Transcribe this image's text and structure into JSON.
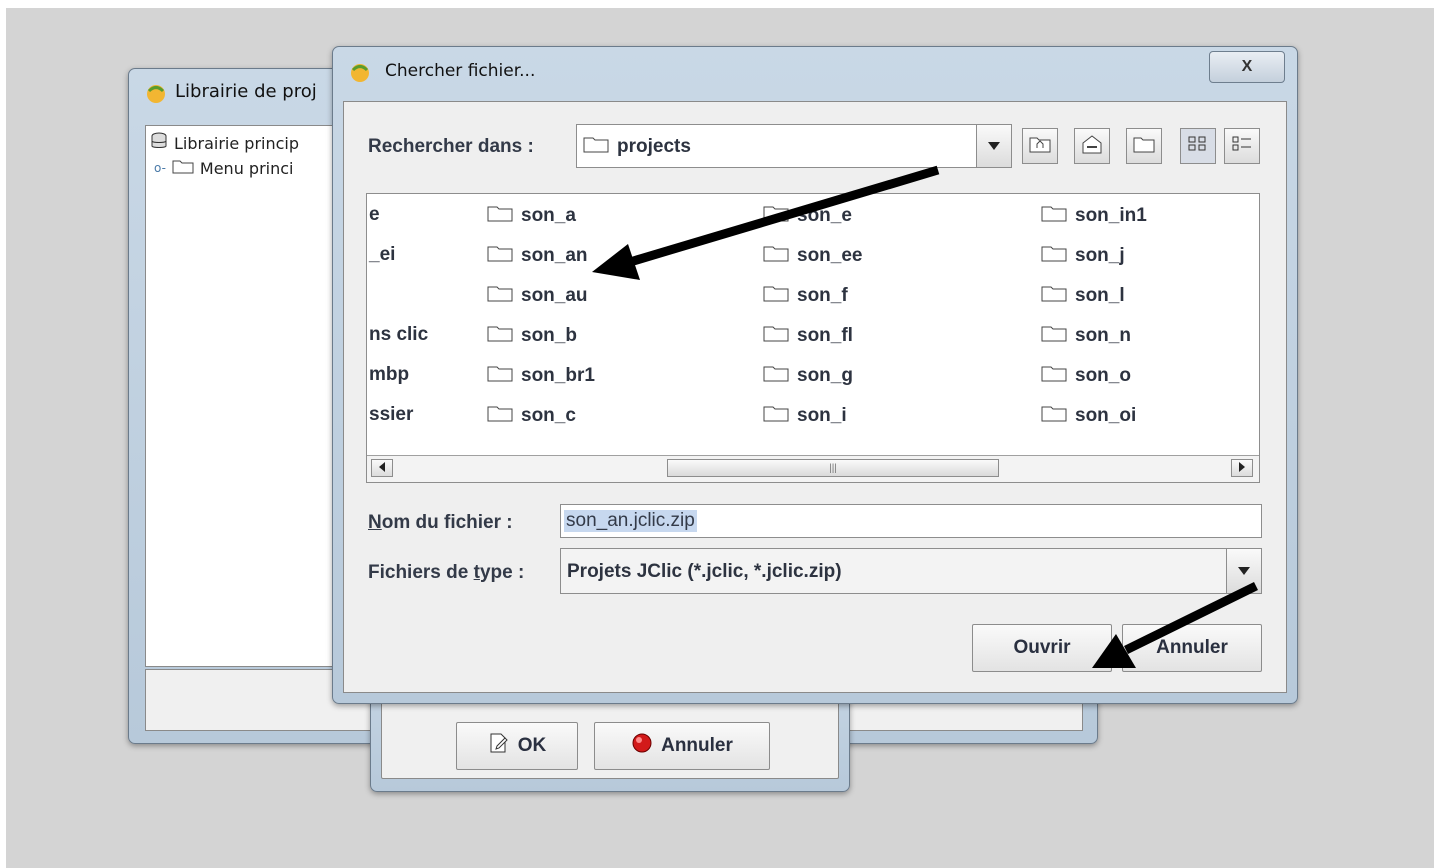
{
  "library_window": {
    "title": "Librairie de proj",
    "tree": [
      {
        "label": "Librairie princip",
        "icon": "database-icon"
      },
      {
        "label": "Menu princi",
        "icon": "folder-icon"
      }
    ]
  },
  "ok_dialog": {
    "ok_label": "OK",
    "cancel_label": "Annuler"
  },
  "chooser": {
    "title": "Chercher fichier...",
    "close_glyph": "X",
    "look_in_label": "Rechercher dans :",
    "look_in_value": "projects",
    "toolbar_icons": [
      "up-folder-icon",
      "home-icon",
      "new-folder-icon",
      "list-view-icon",
      "details-view-icon"
    ],
    "columns": [
      [
        "e",
        "_ei",
        "",
        "ns clic",
        "mbp",
        "ssier"
      ],
      [
        "son_a",
        "son_an",
        "son_au",
        "son_b",
        "son_br1",
        "son_c"
      ],
      [
        "son_e",
        "son_ee",
        "son_f",
        "son_fl",
        "son_g",
        "son_i"
      ],
      [
        "son_in1",
        "son_j",
        "son_l",
        "son_n",
        "son_o",
        "son_oi"
      ]
    ],
    "scroll_thumb_grip": "|||",
    "filename_label_underlined": "N",
    "filename_label_rest": "om du fichier :",
    "filename_value": "son_an.jclic.zip",
    "filetype_label_pre": "Fichiers de ",
    "filetype_label_underlined": "t",
    "filetype_label_post": "ype :",
    "filetype_value": "Projets JClic (*.jclic, *.jclic.zip)",
    "open_label": "Ouvrir",
    "cancel_label": "Annuler"
  },
  "colors": {
    "frame": "#b7c9da",
    "annotation_arrow": "#000000",
    "selection": "#c7d8ef"
  }
}
